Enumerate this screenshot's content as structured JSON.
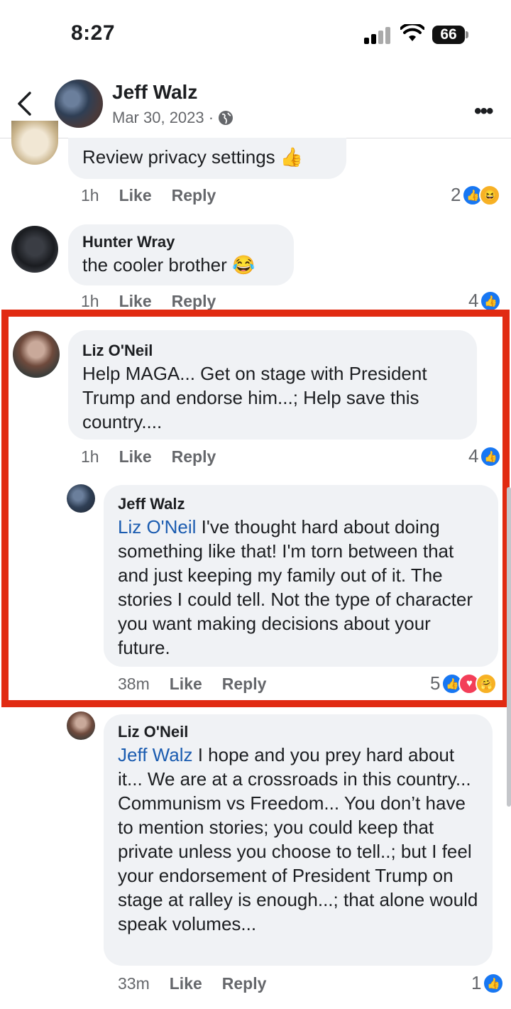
{
  "status": {
    "time": "8:27",
    "battery": "66"
  },
  "header": {
    "name": "Jeff Walz",
    "date": "Mar 30, 2023 ·"
  },
  "comments": [
    {
      "author": "",
      "text": "Review privacy settings 👍",
      "time": "1h",
      "like": "Like",
      "reply": "Reply",
      "count": "2"
    },
    {
      "author": "Hunter Wray",
      "text": "the cooler brother 😂",
      "time": "1h",
      "like": "Like",
      "reply": "Reply",
      "count": "4"
    },
    {
      "author": "Liz O'Neil",
      "text": "Help MAGA... Get on stage with President Trump and endorse him...; Help save this country....",
      "time": "1h",
      "like": "Like",
      "reply": "Reply",
      "count": "4"
    },
    {
      "author": "Jeff Walz",
      "mention": "Liz O'Neil",
      "text": " I've thought hard about doing something like that! I'm torn between that and just keeping my family out of it. The stories I could tell. Not the type of character you want making decisions about your future.",
      "time": "38m",
      "like": "Like",
      "reply": "Reply",
      "count": "5"
    },
    {
      "author": "Liz O'Neil",
      "mention": "Jeff Walz",
      "text": " I hope and you prey hard about it... We are at a crossroads in this country... Communism vs Freedom... You don’t have to mention stories; you could keep that private unless you choose to tell..; but I feel your endorsement of President Trump on stage at ralley is enough...; that alone would speak volumes...",
      "time": "33m",
      "like": "Like",
      "reply": "Reply",
      "count": "1"
    }
  ],
  "colors": {
    "highlight": "#e12b12",
    "mention": "#1b5cb0",
    "like": "#1877f2"
  },
  "icons": [
    "back-chevron-icon",
    "globe-icon",
    "more-icon",
    "like-reaction-icon",
    "love-reaction-icon",
    "haha-reaction-icon"
  ]
}
